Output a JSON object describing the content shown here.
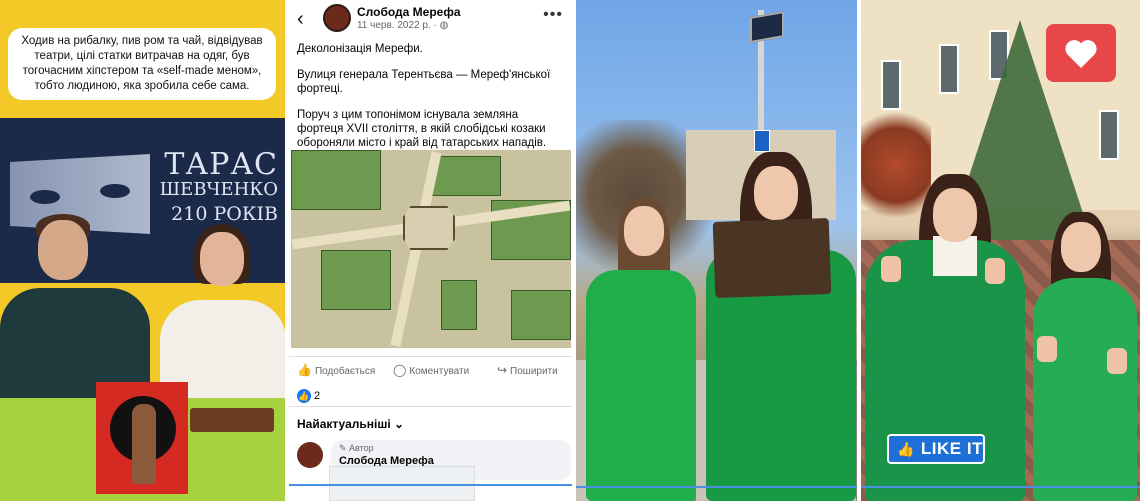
{
  "panel1": {
    "quote": "Ходив на рибалку, пив ром та чай, відвідував театри, цілі статки витрачав на одяг, був тогочасним хіпстером та «self-made меном», тобто людиною, яка зробила себе сама.",
    "banner_line1": "ТАРАС",
    "banner_line2": "ШЕВЧЕНКО",
    "banner_line3": "210 РОКІВ"
  },
  "panel2": {
    "page_name": "Слобода Мерефа",
    "post_date": "11 черв. 2022 р. ·",
    "post_paragraphs": [
      "Деколонізація Мерефи.",
      "Вулиця генерала Терентьєва — Мереф'янської фортеці.",
      "Поруч з цим топонімом існувала земляна фортеця XVII століття, в якій слобідські козаки обороняли місто і край від татарських нападів."
    ],
    "actions": {
      "like": "Подобається",
      "comment": "Коментувати",
      "share": "Поширити"
    },
    "reaction_count": "2",
    "sort_label": "Найактуальніші",
    "comment": {
      "author_badge": "Автор",
      "name": "Слобода Мерефа"
    }
  },
  "panel4": {
    "like_button_label": "LIKE IT"
  },
  "icons": [
    "back-arrow-icon",
    "globe-icon",
    "more-dots-icon",
    "thumbs-up-icon",
    "comment-icon",
    "share-icon",
    "chevron-down-icon",
    "pencil-icon",
    "heart-icon"
  ],
  "colors": {
    "panel1_bg": "#f3c928",
    "facebook_blue": "#1877f2",
    "heart_red": "#e8474a",
    "outfit_green": "#1fae4a"
  }
}
